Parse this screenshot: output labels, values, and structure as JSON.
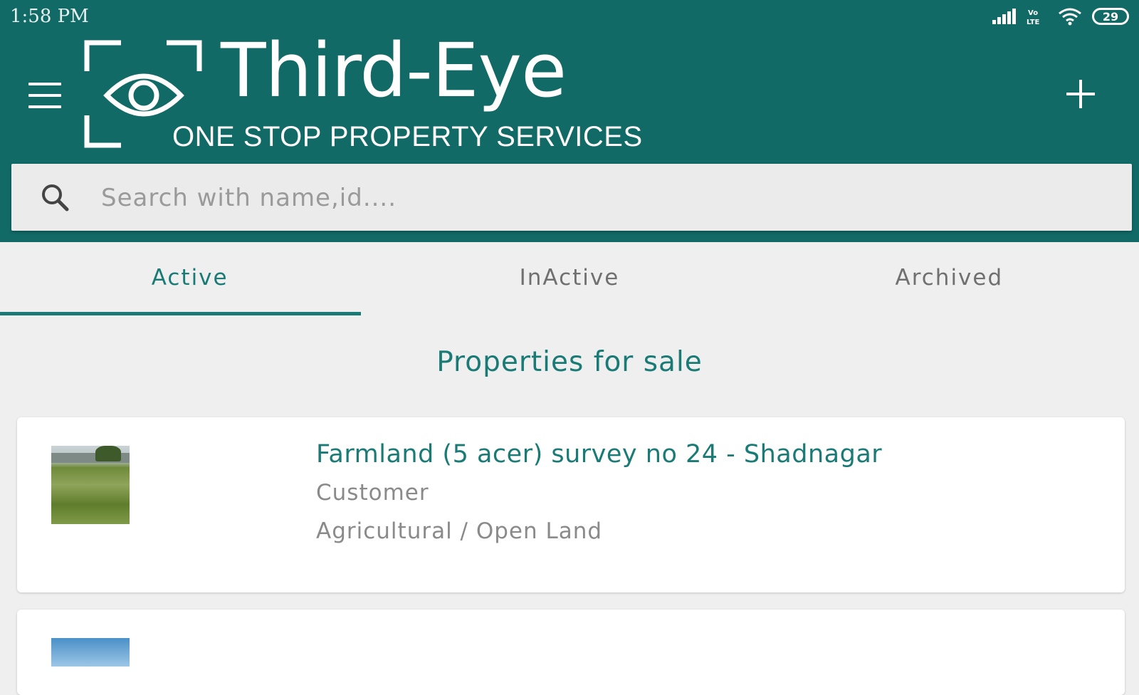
{
  "status_bar": {
    "time": "1:58 PM",
    "battery": "29",
    "icons": [
      "signal-icon",
      "volte-icon",
      "wifi-icon",
      "battery-icon"
    ]
  },
  "app_bar": {
    "brand_name": "Third-Eye",
    "brand_tagline": "ONE STOP PROPERTY SERVICES",
    "background_color": "#116a66",
    "menu_icon": "hamburger-menu-icon",
    "add_icon": "plus-icon"
  },
  "search": {
    "placeholder": "Search with name,id....",
    "value": "",
    "icon": "search-icon"
  },
  "tabs": [
    {
      "label": "Active",
      "active": true
    },
    {
      "label": "InActive",
      "active": false
    },
    {
      "label": "Archived",
      "active": false
    }
  ],
  "accent_color": "#1a7b76",
  "section_title": "Properties for sale",
  "properties": [
    {
      "title": "Farmland (5 acer) survey no 24 - Shadnagar",
      "owner": "Customer",
      "type": "Agricultural / Open Land"
    }
  ]
}
